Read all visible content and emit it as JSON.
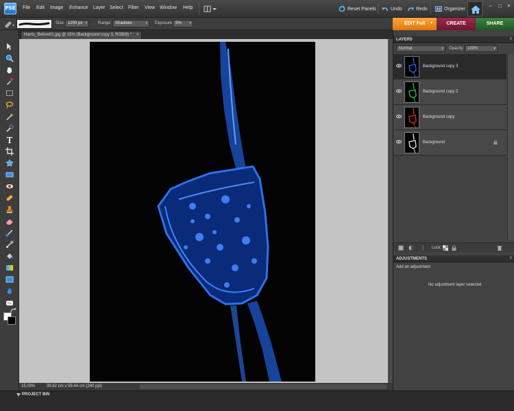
{
  "app": {
    "logo_text": "PSE",
    "menu": [
      "File",
      "Edit",
      "Image",
      "Enhance",
      "Layer",
      "Select",
      "Filter",
      "View",
      "Window",
      "Help"
    ],
    "reset_panels": "Reset Panels",
    "undo": "Undo",
    "redo": "Redo",
    "organizer": "Organizer"
  },
  "options": {
    "size_label": "Size:",
    "size_value": "1200 px",
    "range_label": "Range:",
    "range_value": "Shadows",
    "exposure_label": "Exposure:",
    "exposure_value": "5%"
  },
  "mode_tabs": {
    "edit": "EDIT Full",
    "create": "CREATE",
    "share": "SHARE"
  },
  "document": {
    "tab_title": "Harris_Before01.jpg @ 15% (Background copy 3, RGB/8) *",
    "zoom": "15.03%",
    "doc_size": "39.62 cm x 59.44 cm (240 ppi)"
  },
  "layers": {
    "title": "LAYERS",
    "blend_mode": "Normal",
    "opacity_label": "Opacity:",
    "opacity_value": "100%",
    "lock_label": "Lock:",
    "items": [
      {
        "name": "Background copy 3",
        "color": "#1f5fd6"
      },
      {
        "name": "Background copy 2",
        "color": "#19b34a"
      },
      {
        "name": "Background copy",
        "color": "#d22525"
      },
      {
        "name": "Background",
        "color": "#d0d0d0"
      }
    ]
  },
  "adjustments": {
    "title": "ADJUSTMENTS",
    "add_label": "Add an adjustment",
    "empty_message": "No adjustment layer selected"
  },
  "project_bin": {
    "title": "PROJECT BIN"
  },
  "colors": {
    "accent_edit": "#f08a1c",
    "create_tab": "#8a1f3a",
    "share_tab": "#2e6b2e",
    "glass": "#1e5bd6"
  }
}
